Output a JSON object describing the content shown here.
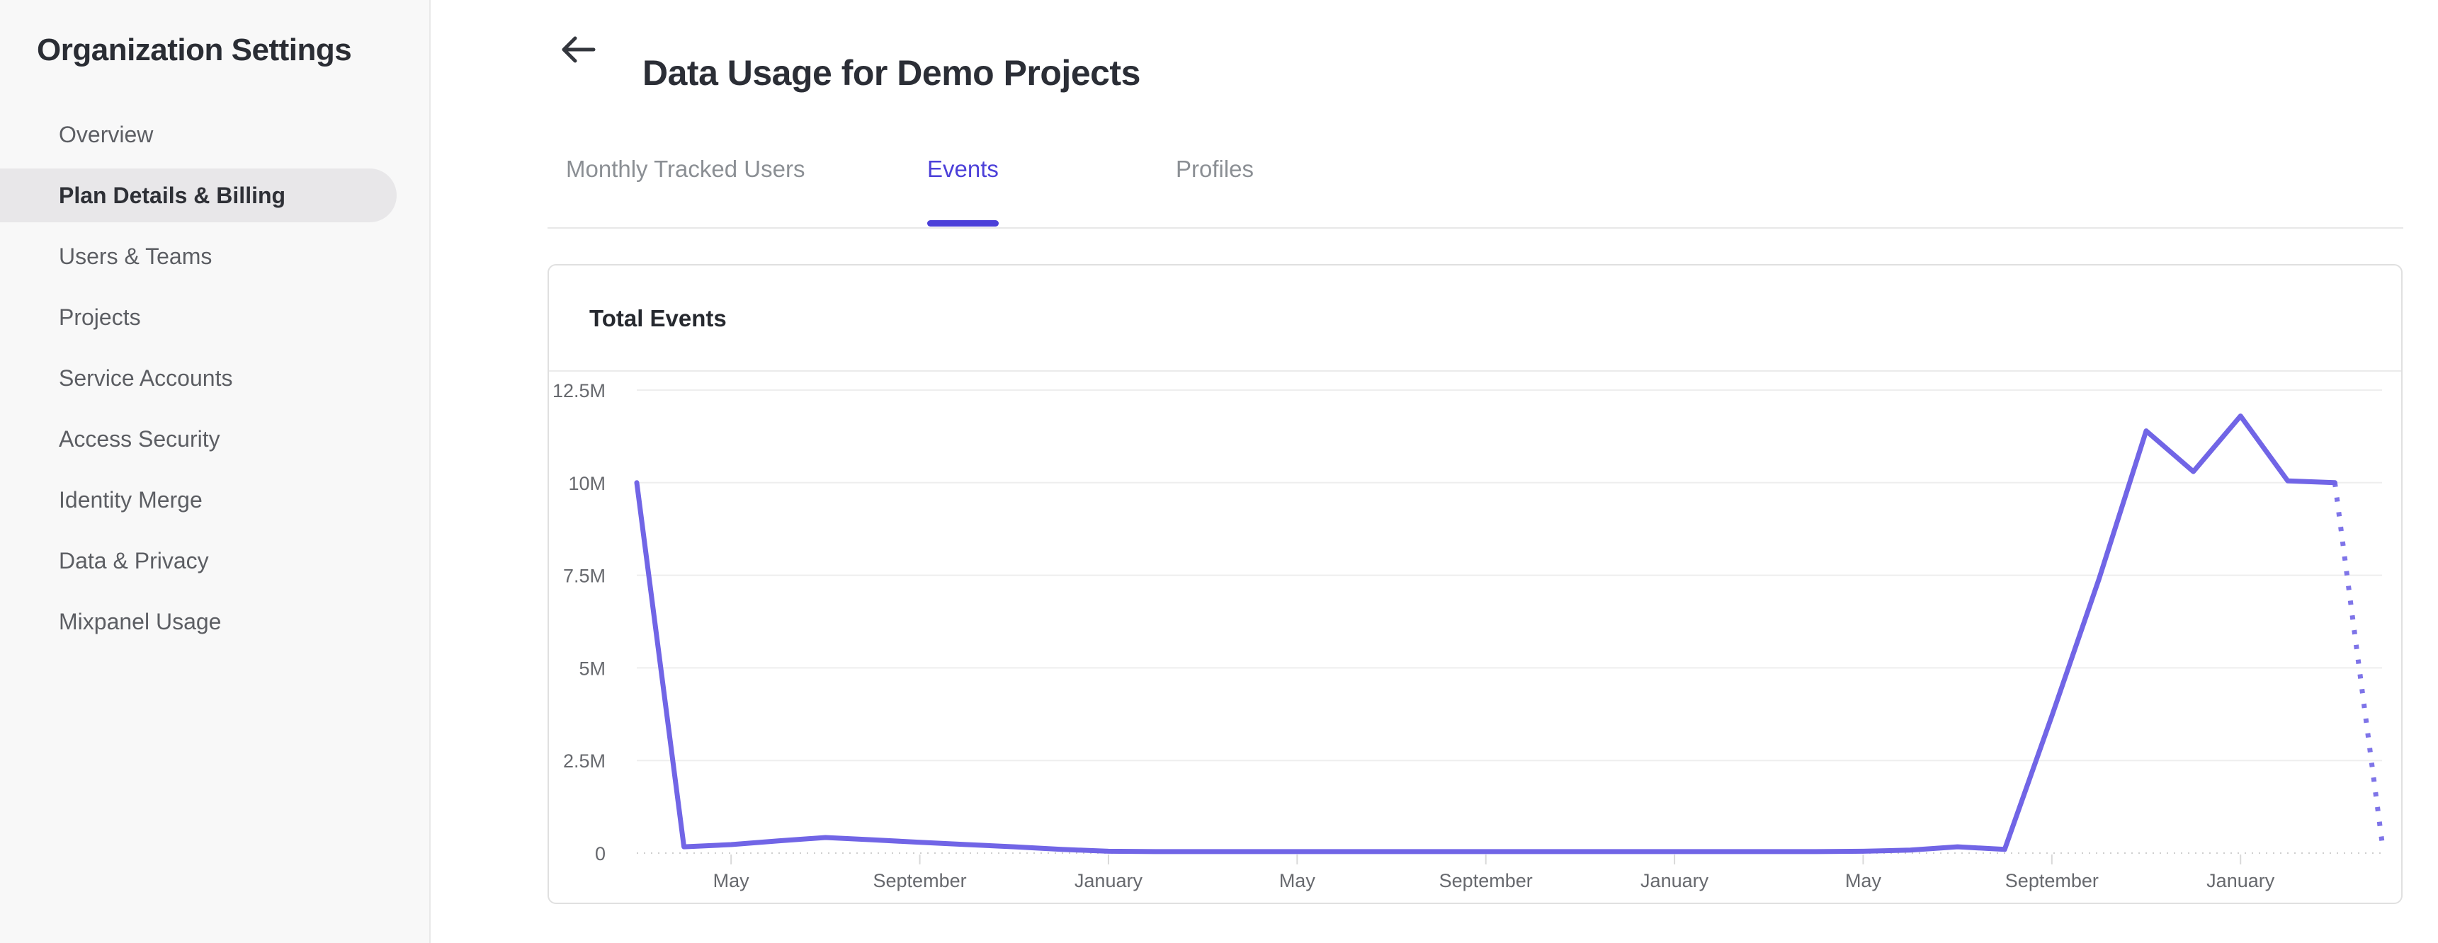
{
  "sidebar": {
    "title": "Organization Settings",
    "items": [
      {
        "label": "Overview",
        "selected": false
      },
      {
        "label": "Plan Details & Billing",
        "selected": true
      },
      {
        "label": "Users & Teams",
        "selected": false
      },
      {
        "label": "Projects",
        "selected": false
      },
      {
        "label": "Service Accounts",
        "selected": false
      },
      {
        "label": "Access Security",
        "selected": false
      },
      {
        "label": "Identity Merge",
        "selected": false
      },
      {
        "label": "Data & Privacy",
        "selected": false
      },
      {
        "label": "Mixpanel Usage",
        "selected": false
      }
    ]
  },
  "header": {
    "back_icon": "arrow-left-icon",
    "title": "Data Usage for Demo Projects"
  },
  "tabs": [
    {
      "label": "Monthly Tracked Users",
      "active": false
    },
    {
      "label": "Events",
      "active": true
    },
    {
      "label": "Profiles",
      "active": false
    }
  ],
  "card": {
    "title": "Total Events"
  },
  "colors": {
    "accent": "#4c40d9",
    "line": "#7165e6",
    "sidebar_bg": "#f8f8f8",
    "selected_pill": "#e8e7e9",
    "gridline": "#eeeeee",
    "zero_line": "#cfcfcf",
    "axis_label": "#67696e",
    "tick": "#d9d9d9"
  },
  "chart_data": {
    "type": "line",
    "title": "Total Events",
    "unit": "events (millions)",
    "legend": false,
    "grid": true,
    "series": [
      {
        "name": "Total Events",
        "color": "#7165e6",
        "values_millions": [
          10,
          0.17,
          0.23,
          0.33,
          0.42,
          0.36,
          0.29,
          0.23,
          0.17,
          0.1,
          0.05,
          0.04,
          0.04,
          0.04,
          0.04,
          0.04,
          0.04,
          0.04,
          0.04,
          0.04,
          0.04,
          0.04,
          0.04,
          0.04,
          0.04,
          0.04,
          0.05,
          0.08,
          0.17,
          0.1,
          3.7,
          7.4,
          11.4,
          10.3,
          11.8,
          10.05,
          10,
          0.3
        ],
        "last_point_projected_dotted": true
      }
    ],
    "x_axis": {
      "tick_indices": [
        2,
        6,
        10,
        14,
        18,
        22,
        26,
        30,
        34
      ],
      "tick_labels": [
        "May",
        "September",
        "January",
        "May",
        "September",
        "January",
        "May",
        "September",
        "January"
      ]
    },
    "y_axis": {
      "tick_labels": [
        "12.5M",
        "10M",
        "7.5M",
        "5M",
        "2.5M",
        "0"
      ],
      "tick_values_millions": [
        12.5,
        10,
        7.5,
        5,
        2.5,
        0
      ],
      "range_millions": [
        0,
        12.5
      ]
    }
  }
}
